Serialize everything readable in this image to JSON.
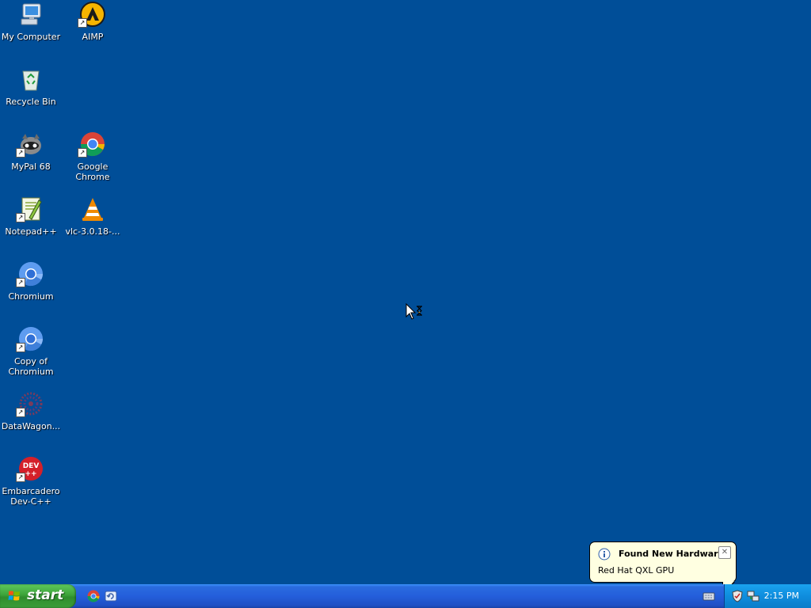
{
  "desktop": {
    "background_color": "#004e98",
    "icons": [
      {
        "label": "My Computer",
        "icon": "computer-icon",
        "shortcut": false
      },
      {
        "label": "AIMP",
        "icon": "aimp-icon",
        "shortcut": true
      },
      {
        "label": "Recycle Bin",
        "icon": "recycle-bin-icon",
        "shortcut": false
      },
      {
        "label": "MyPal 68",
        "icon": "mypal-icon",
        "shortcut": true
      },
      {
        "label": "Google Chrome",
        "icon": "chrome-icon",
        "shortcut": true
      },
      {
        "label": "Notepad++",
        "icon": "notepadpp-icon",
        "shortcut": true
      },
      {
        "label": "vlc-3.0.18-...",
        "icon": "vlc-icon",
        "shortcut": false
      },
      {
        "label": "Chromium",
        "icon": "chromium-icon",
        "shortcut": true
      },
      {
        "label": "Copy of Chromium",
        "icon": "chromium-icon",
        "shortcut": true
      },
      {
        "label": "DataWagon...",
        "icon": "datawagon-icon",
        "shortcut": true
      },
      {
        "label": "Embarcadero Dev-C++",
        "icon": "devcpp-icon",
        "shortcut": true
      }
    ]
  },
  "taskbar": {
    "start_label": "start",
    "quick_launch": [
      "chrome-icon",
      "refresh-browser-icon"
    ],
    "tray_icons": [
      "keyboard-icon",
      "shield-icon",
      "network-icon"
    ],
    "clock": "2:15 PM"
  },
  "balloon": {
    "title": "Found New Hardware",
    "text": "Red Hat QXL GPU",
    "icon": "info-icon"
  },
  "cursor": {
    "icon": "busy-cursor-icon"
  }
}
